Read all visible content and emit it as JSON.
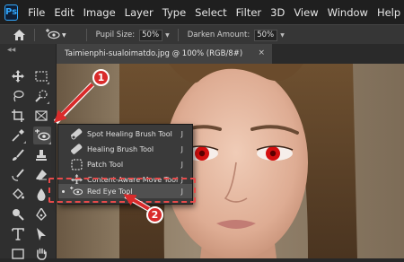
{
  "app": {
    "logo_text": "Ps"
  },
  "menu": [
    "File",
    "Edit",
    "Image",
    "Layer",
    "Type",
    "Select",
    "Filter",
    "3D",
    "View",
    "Window",
    "Help"
  ],
  "options": {
    "pupil_label": "Pupil Size:",
    "pupil_value": "50%",
    "darken_label": "Darken Amount:",
    "darken_value": "50%"
  },
  "document": {
    "tab_title": "Taimienphi-sualoimatdo.jpg @ 100% (RGB/8#)",
    "close_glyph": "×"
  },
  "flyout": {
    "items": [
      {
        "label": "Spot Healing Brush Tool",
        "shortcut": "J",
        "icon": "spot-healing-brush-icon"
      },
      {
        "label": "Healing Brush Tool",
        "shortcut": "J",
        "icon": "healing-brush-icon"
      },
      {
        "label": "Patch Tool",
        "shortcut": "J",
        "icon": "patch-icon"
      },
      {
        "label": "Content-Aware Move Tool",
        "shortcut": "J",
        "icon": "content-aware-move-icon"
      },
      {
        "label": "Red Eye Tool",
        "shortcut": "J",
        "icon": "red-eye-icon",
        "selected": true
      }
    ]
  },
  "annotations": {
    "step1": "1",
    "step2": "2",
    "color": "#d92b2b"
  },
  "colors": {
    "accent": "#31a8ff",
    "highlight": "#e84a4a",
    "red_eye": "#d40f0f"
  }
}
